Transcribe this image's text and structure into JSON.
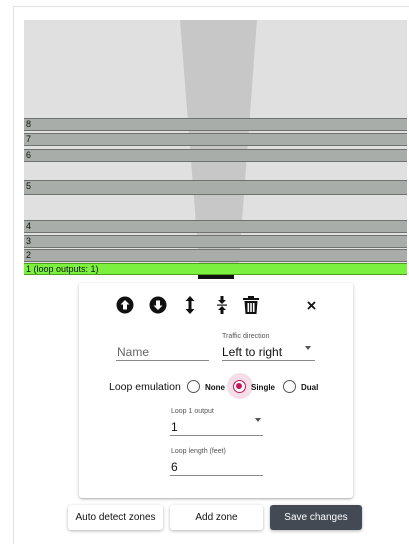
{
  "zones": {
    "lanes": [
      "8",
      "7",
      "6",
      "5",
      "4",
      "3",
      "2"
    ],
    "selected_lane": "1 (loop outputs: 1)"
  },
  "toolbar": {
    "icons": [
      "arrow-up-circle-icon",
      "arrow-down-circle-icon",
      "expand-vertical-icon",
      "compress-vertical-icon",
      "trash-icon",
      "close-icon"
    ]
  },
  "form": {
    "name_placeholder": "Name",
    "traffic_direction_label": "Traffic direction",
    "traffic_direction_value": "Left to right",
    "loop_emulation_label": "Loop emulation",
    "loop_options": [
      "None",
      "Single",
      "Dual"
    ],
    "loop_selected": "Single",
    "loop1_output_label": "Loop 1 output",
    "loop1_output_value": "1",
    "loop_length_label": "Loop length (feet)",
    "loop_length_value": "6"
  },
  "actions": {
    "auto_detect": "Auto detect zones",
    "add_zone": "Add zone",
    "save": "Save changes"
  },
  "colors": {
    "selected_zone": "#7cf03f",
    "lane": "#a9ada9",
    "radio_accent": "#c2185b",
    "primary_button": "#434a54"
  }
}
